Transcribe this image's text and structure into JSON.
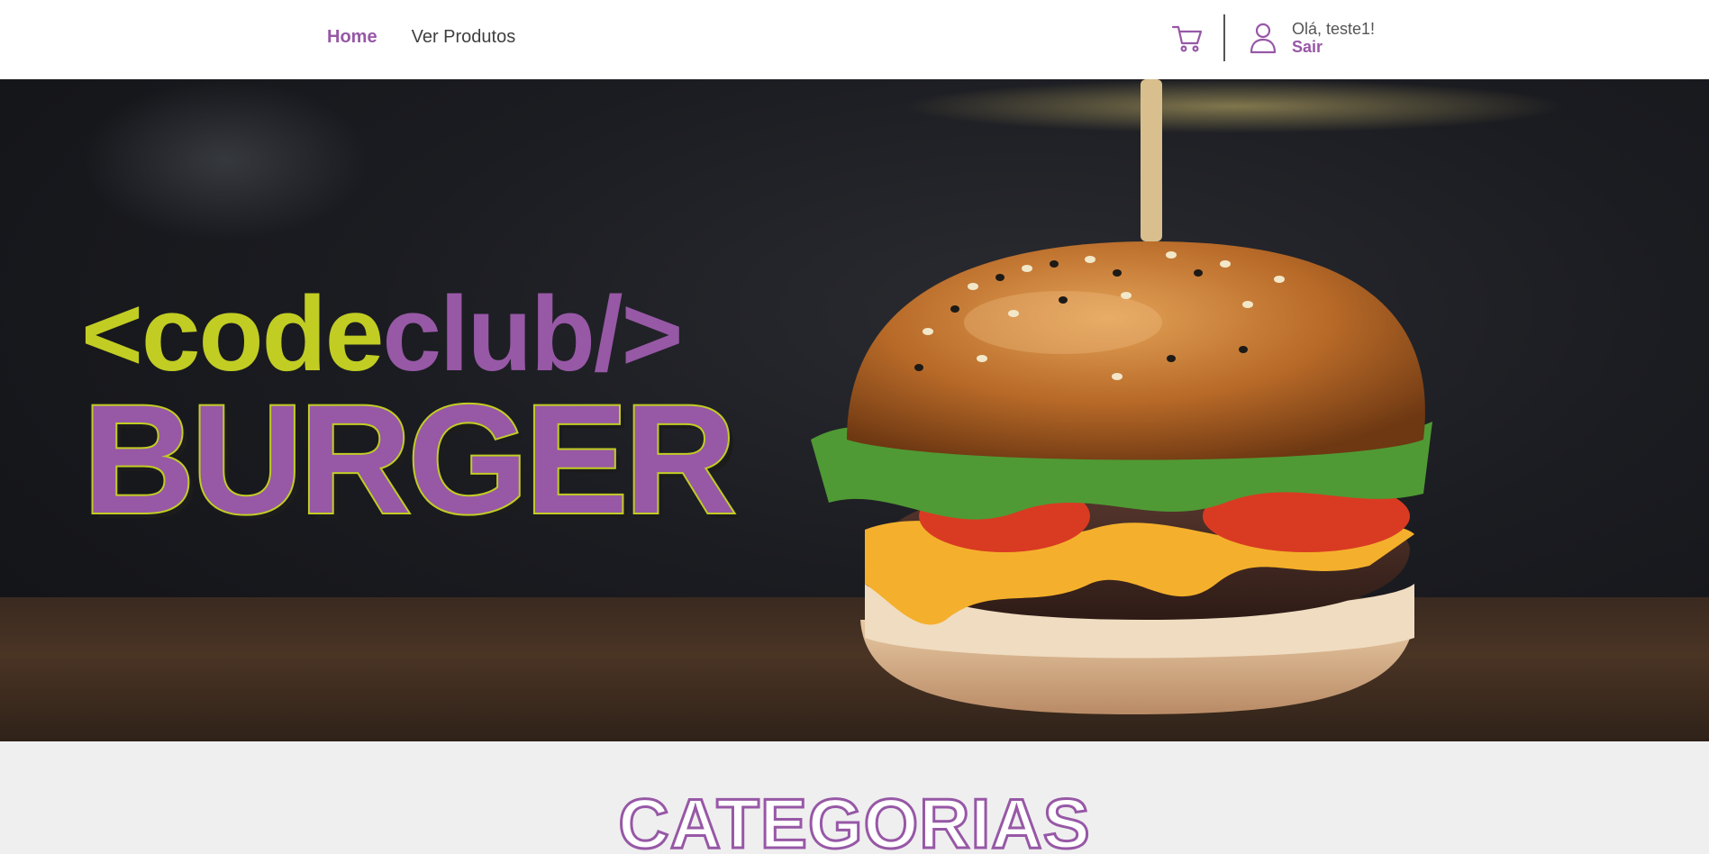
{
  "nav": {
    "items": [
      {
        "label": "Home",
        "active": true
      },
      {
        "label": "Ver Produtos",
        "active": false
      }
    ]
  },
  "user": {
    "greeting": "Olá, teste1!",
    "logout_label": "Sair"
  },
  "hero": {
    "logo_prefix": "<code",
    "logo_suffix": "club/>",
    "logo_word": "BURGER"
  },
  "categories": {
    "title": "CATEGORIAS"
  },
  "colors": {
    "brand_purple": "#9758a6",
    "brand_lime": "#c1cd23"
  },
  "icons": {
    "cart": "cart-icon",
    "user": "user-icon"
  }
}
